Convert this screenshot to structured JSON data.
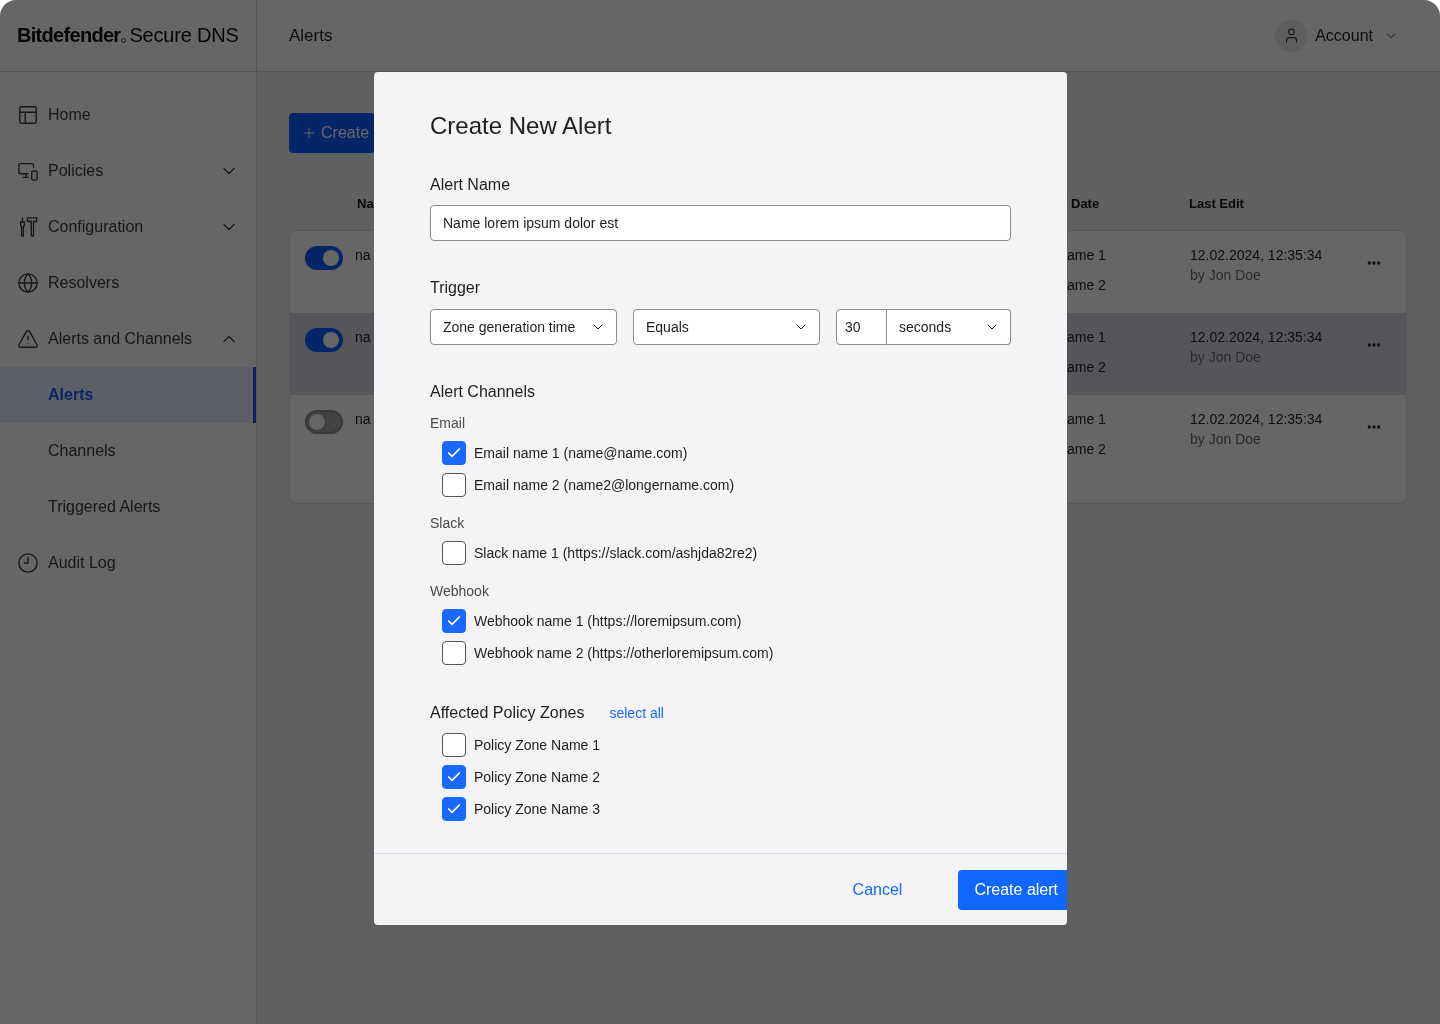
{
  "sidebar": {
    "logo": {
      "brand": "Bitdefender",
      "product": "Secure DNS"
    },
    "items": [
      {
        "label": "Home",
        "selected": false
      },
      {
        "label": "Policies",
        "selected": false,
        "expanded": false
      },
      {
        "label": "Configuration",
        "selected": false,
        "expanded": false
      },
      {
        "label": "Resolvers",
        "selected": false
      },
      {
        "label": "Alerts and Channels",
        "selected": false,
        "expanded": true,
        "children": [
          {
            "label": "Alerts",
            "selected": true
          },
          {
            "label": "Channels",
            "selected": false
          },
          {
            "label": "Triggered Alerts",
            "selected": false
          }
        ]
      },
      {
        "label": "Audit Log",
        "selected": false
      }
    ]
  },
  "header": {
    "title": "Alerts",
    "account": {
      "label": "Account"
    }
  },
  "content": {
    "create_button": {
      "label": "Create"
    },
    "table": {
      "columns": [
        {
          "label": "Na"
        },
        {
          "label": "Date"
        },
        {
          "label": "Last Edit"
        }
      ],
      "rows": [
        {
          "enabled": true,
          "hovered": false,
          "column_2": "na",
          "column_3": [
            "ame 1",
            "ame 2"
          ],
          "last_edit": "12.02.2024, 12:35:34",
          "edited_by": "by Jon Doe"
        },
        {
          "enabled": true,
          "hovered": true,
          "column_2": "na",
          "column_3": [
            "ame 1",
            "ame 2"
          ],
          "last_edit": "12.02.2024, 12:35:34",
          "edited_by": "by Jon Doe"
        },
        {
          "enabled": false,
          "hovered": false,
          "column_2": "na",
          "column_3": [
            "ame 1",
            "ame 2"
          ],
          "last_edit": "12.02.2024, 12:35:34",
          "edited_by": "by Jon Doe"
        }
      ]
    }
  },
  "dialog": {
    "title": "Create New Alert",
    "alert_name": {
      "label": "Alert Name",
      "value": "Name lorem ipsum dolor est"
    },
    "trigger": {
      "label": "Trigger",
      "metric": "Zone generation time",
      "operator": "Equals",
      "threshold": "30",
      "unit": "seconds"
    },
    "channels": {
      "label": "Alert Channels",
      "groups": [
        {
          "label": "Email",
          "items": [
            {
              "label": "Email name 1 (name@name.com)",
              "checked": true
            },
            {
              "label": "Email name 2 (name2@longername.com)",
              "checked": false
            }
          ]
        },
        {
          "label": "Slack",
          "items": [
            {
              "label": "Slack name 1 (https://slack.com/ashjda82re2)",
              "checked": false
            }
          ]
        },
        {
          "label": "Webhook",
          "items": [
            {
              "label": "Webhook name 1 (https://loremipsum.com)",
              "checked": true
            },
            {
              "label": "Webhook name 2 (https://otherloremipsum.com)",
              "checked": false
            }
          ]
        }
      ]
    },
    "policy_zones": {
      "label": "Affected Policy Zones",
      "select_all": "select all",
      "items": [
        {
          "label": "Policy Zone Name 1",
          "checked": false
        },
        {
          "label": "Policy Zone Name 2",
          "checked": true
        },
        {
          "label": "Policy Zone Name 3",
          "checked": true
        }
      ]
    },
    "buttons": {
      "cancel": "Cancel",
      "submit": "Create alert"
    }
  }
}
